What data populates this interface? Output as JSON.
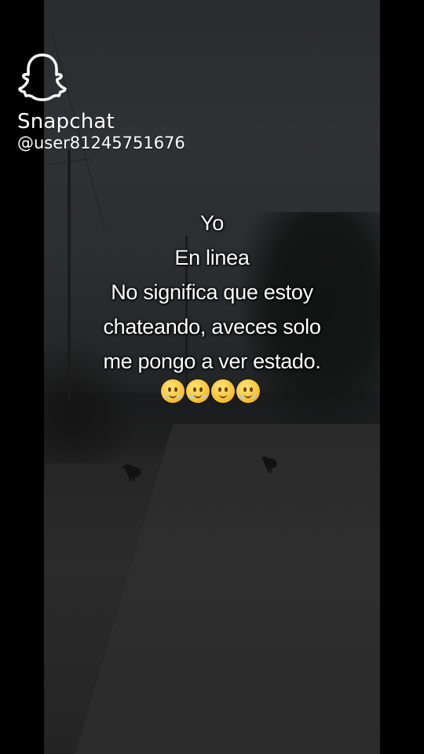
{
  "watermark": {
    "brand": "Snapchat",
    "username": "@user81245751676",
    "logo_icon": "snapchat-ghost-icon"
  },
  "caption": {
    "lines": [
      "Yo",
      "En linea",
      "No significa que estoy",
      "chateando, aveces solo",
      "me pongo a ver estado."
    ],
    "emojis": [
      "pleading-face-icon",
      "pleading-face-icon",
      "slightly-smiling-face-icon",
      "pleading-face-icon"
    ]
  },
  "colors": {
    "text": "#ffffff",
    "background": "#000000"
  }
}
